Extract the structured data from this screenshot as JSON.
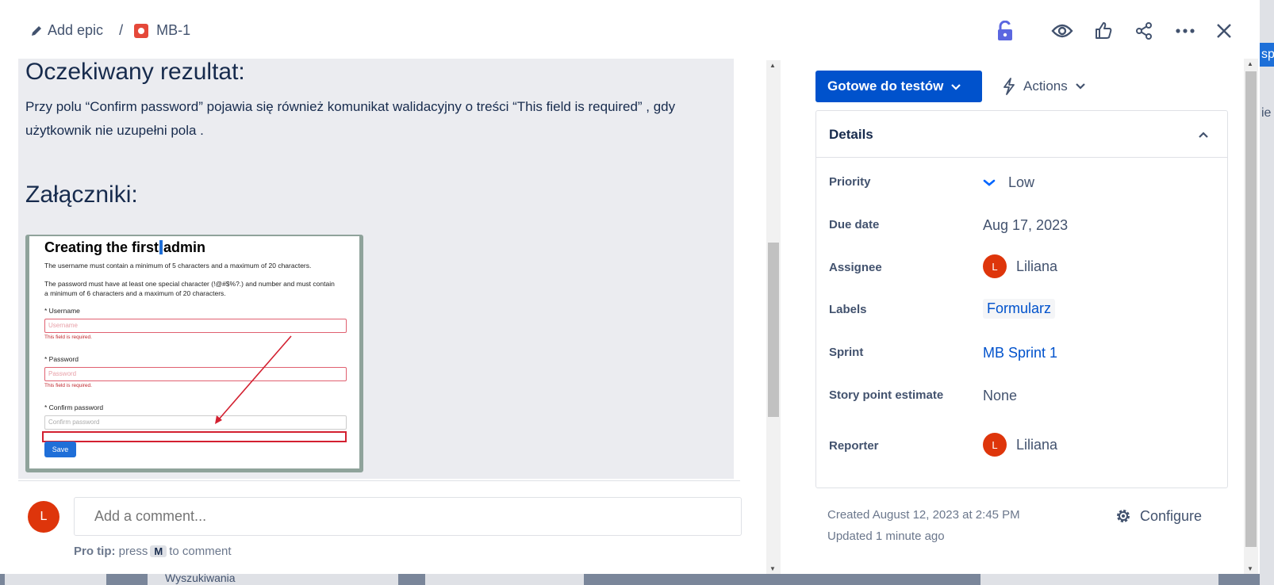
{
  "header": {
    "add_epic": "Add epic",
    "separator": "/",
    "issue_key": "MB-1",
    "icons": [
      "lock-icon",
      "eye-icon",
      "thumbs-up-icon",
      "share-icon",
      "more-icon",
      "close-icon"
    ]
  },
  "description": {
    "result_heading": "Oczekiwany rezultat:",
    "result_text": "Przy polu “Confirm password” pojawia się również komunikat walidacyjny o treści “This field is required” , gdy użytkownik nie uzupełni pola .",
    "attachments_heading": "Załączniki:",
    "attachment": {
      "title_part1": "Creating the first",
      "title_part2": "admin",
      "line1": "The username must contain a minimum of 5 characters and a maximum of 20 characters.",
      "line2": "The password must have at least one special character (!@#$%?.) and number and must contain a minimum of 6 characters and a maximum of 20 characters.",
      "username_label": "* Username",
      "username_placeholder": "Username",
      "username_error": "This field is required.",
      "password_label": "* Password",
      "password_placeholder": "Password",
      "password_error": "This field is required.",
      "confirm_label": "* Confirm password",
      "confirm_placeholder": "Confirm password",
      "save": "Save"
    }
  },
  "comment": {
    "avatar_initial": "L",
    "placeholder": "Add a comment...",
    "tip_bold": "Pro tip:",
    "tip_press": "press",
    "tip_key": "M",
    "tip_rest": "to comment"
  },
  "status": {
    "label": "Gotowe do testów",
    "color": "#0052cc"
  },
  "actions": {
    "label": "Actions"
  },
  "details": {
    "title": "Details",
    "rows": [
      {
        "label": "Priority",
        "value": "Low"
      },
      {
        "label": "Due date",
        "value": "Aug 17, 2023"
      },
      {
        "label": "Assignee",
        "value": "Liliana",
        "avatar": "L"
      },
      {
        "label": "Labels",
        "value": "Formularz"
      },
      {
        "label": "Sprint",
        "value": "MB Sprint 1"
      },
      {
        "label": "Story point estimate",
        "value": "None"
      },
      {
        "label": "Reporter",
        "value": "Liliana",
        "avatar": "L"
      }
    ]
  },
  "footer": {
    "created": "Created August 12, 2023 at 2:45 PM",
    "updated": "Updated 1 minute ago",
    "configure": "Configure"
  },
  "background": {
    "side_tab": "sp",
    "side_text": "ie",
    "bottom_text": "Wyszukiwania"
  }
}
